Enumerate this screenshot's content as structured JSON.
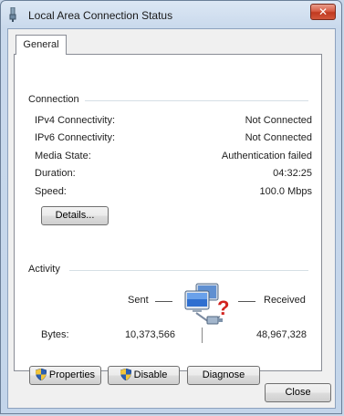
{
  "window": {
    "title": "Local Area Connection Status",
    "close_glyph": "✕"
  },
  "tabs": [
    {
      "label": "General"
    }
  ],
  "connection": {
    "heading": "Connection",
    "rows": [
      {
        "label": "IPv4 Connectivity:",
        "value": "Not Connected"
      },
      {
        "label": "IPv6 Connectivity:",
        "value": "Not Connected"
      },
      {
        "label": "Media State:",
        "value": "Authentication failed"
      },
      {
        "label": "Duration:",
        "value": "04:32:25"
      },
      {
        "label": "Speed:",
        "value": "100.0 Mbps"
      }
    ],
    "details_label": "Details..."
  },
  "activity": {
    "heading": "Activity",
    "sent_label": "Sent",
    "received_label": "Received",
    "bytes_label": "Bytes:",
    "bytes_sent": "10,373,566",
    "bytes_received": "48,967,328"
  },
  "buttons": {
    "properties": "Properties",
    "disable": "Disable",
    "diagnose": "Diagnose",
    "close": "Close"
  },
  "icons": {
    "title": "network-plug-icon",
    "network": "network-problem-icon",
    "shield": "uac-shield-icon"
  }
}
